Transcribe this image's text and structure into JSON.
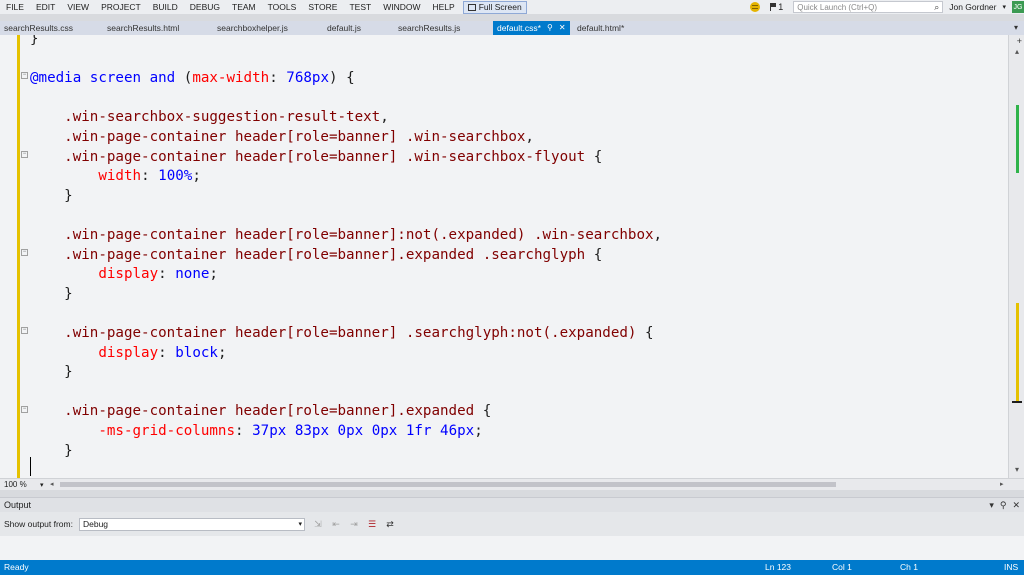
{
  "menu": {
    "items": [
      "FILE",
      "EDIT",
      "VIEW",
      "PROJECT",
      "BUILD",
      "DEBUG",
      "TEAM",
      "TOOLS",
      "STORE",
      "TEST",
      "WINDOW",
      "HELP"
    ],
    "fullscreen": "Full Screen",
    "notifications": "1",
    "quick_launch_placeholder": "Quick Launch (Ctrl+Q)",
    "user": "Jon Gordner",
    "user_badge": "JG"
  },
  "tabs": [
    {
      "label": "searchResults.css"
    },
    {
      "label": "searchResults.html"
    },
    {
      "label": "searchboxhelper.js"
    },
    {
      "label": "default.js"
    },
    {
      "label": "searchResults.js"
    },
    {
      "label": "default.css*",
      "active": true
    },
    {
      "label": "default.html*"
    }
  ],
  "code_lines": [
    "}",
    "",
    "@media screen and (max-width: 768px) {",
    "",
    "    .win-searchbox-suggestion-result-text,",
    "    .win-page-container header[role=banner] .win-searchbox,",
    "    .win-page-container header[role=banner] .win-searchbox-flyout {",
    "        width: 100%;",
    "    }",
    "",
    "    .win-page-container header[role=banner]:not(.expanded) .win-searchbox,",
    "    .win-page-container header[role=banner].expanded .searchglyph {",
    "        display: none;",
    "    }",
    "",
    "    .win-page-container header[role=banner] .searchglyph:not(.expanded) {",
    "        display: block;",
    "    }",
    "",
    "    .win-page-container header[role=banner].expanded {",
    "        -ms-grid-columns: 37px 83px 0px 0px 1fr 46px;",
    "    }",
    "",
    "}"
  ],
  "zoom": "100 %",
  "output": {
    "title": "Output",
    "show_from_label": "Show output from:",
    "show_from_value": "Debug"
  },
  "status": {
    "state": "Ready",
    "line": "Ln 123",
    "col": "Col 1",
    "ch": "Ch 1",
    "mode": "INS"
  },
  "colors": {
    "accent": "#007acc",
    "selector": "#800000",
    "keyword": "#0000ff",
    "property": "#ff0000",
    "value": "#0000ff",
    "changed_margin": "#e5c100",
    "saved_margin": "#2fb34a"
  }
}
